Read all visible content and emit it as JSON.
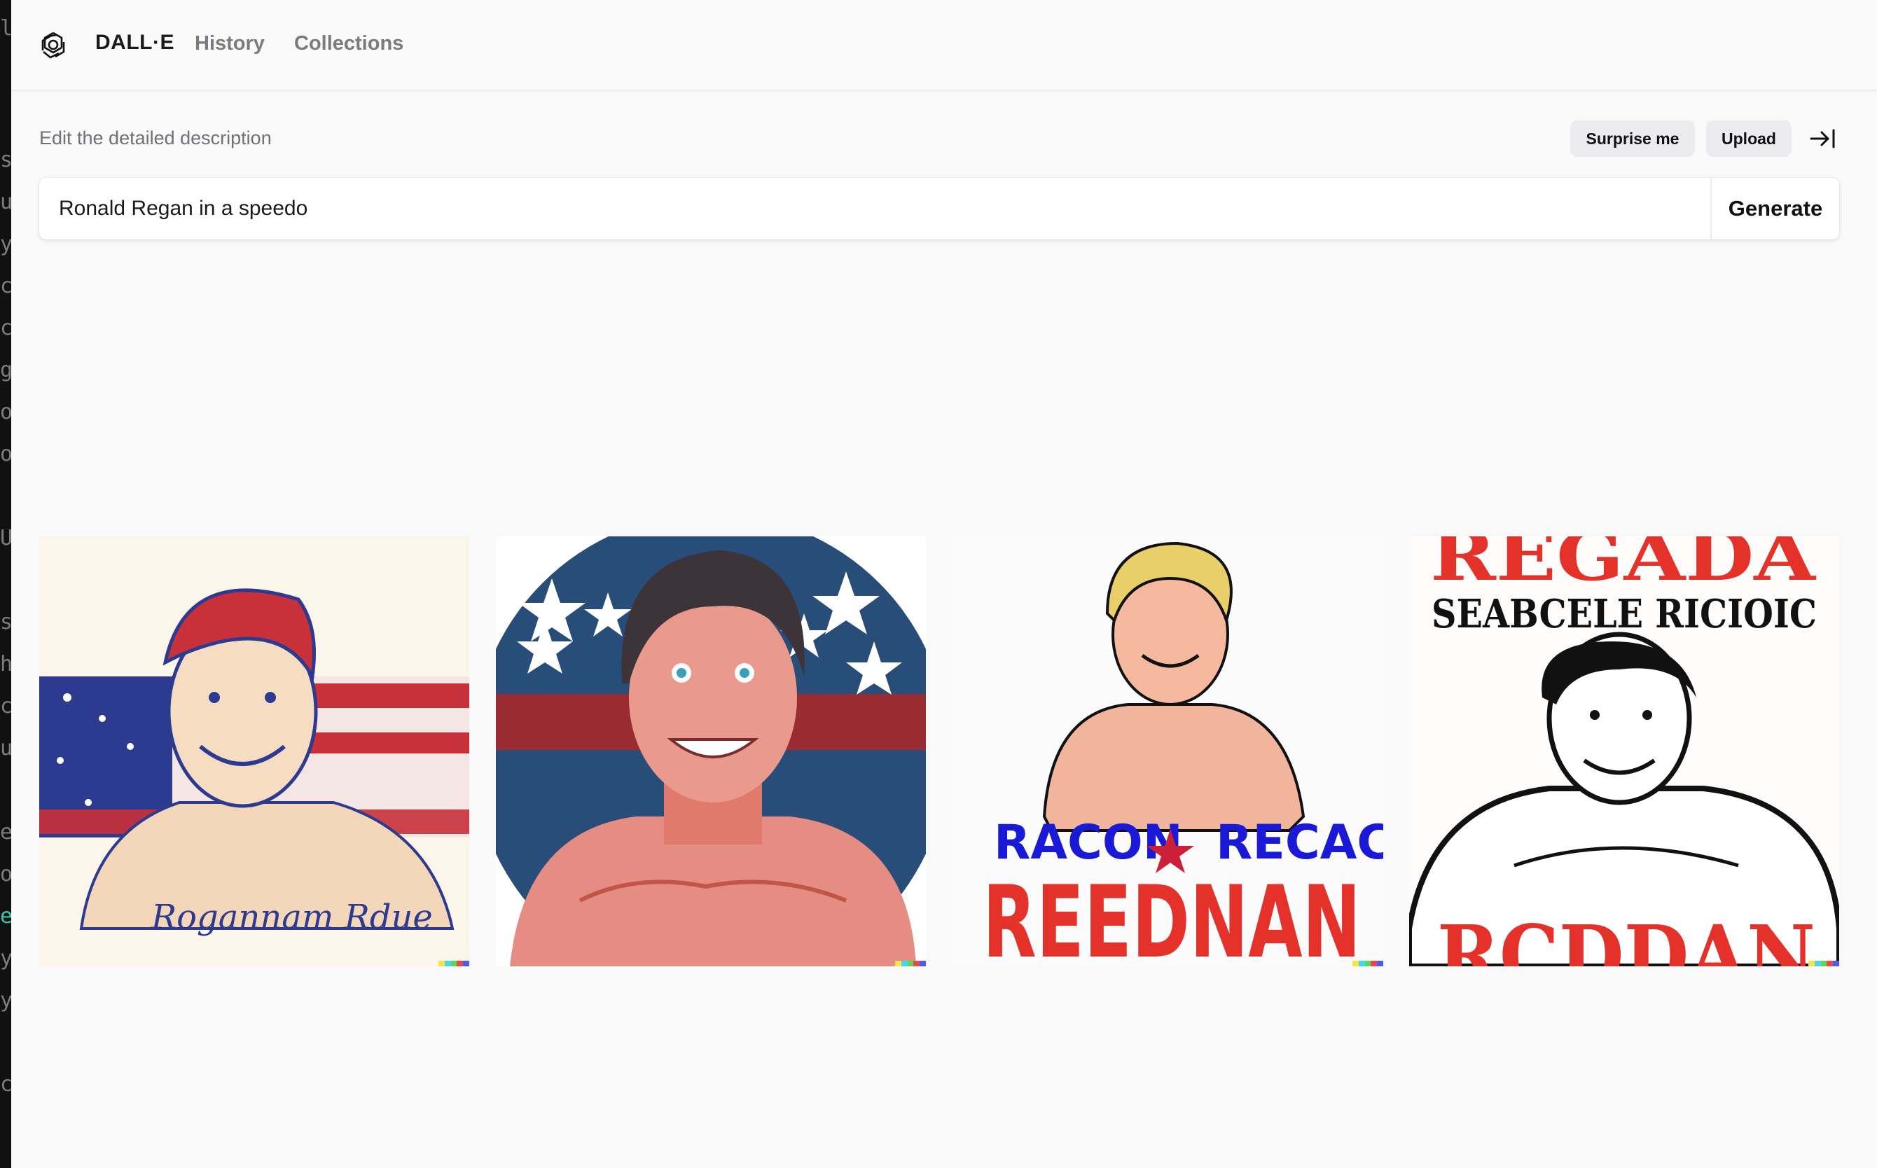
{
  "header": {
    "brand": "DALL·E",
    "nav": [
      {
        "label": "History"
      },
      {
        "label": "Collections"
      }
    ]
  },
  "toolbar": {
    "prompt_label": "Edit the detailed description",
    "surprise_label": "Surprise me",
    "upload_label": "Upload"
  },
  "prompt": {
    "value": "Ronald Regan in a speedo",
    "generate_label": "Generate"
  },
  "images": [
    {
      "art_text": "Rogannam Rdue"
    },
    {
      "art_text": ""
    },
    {
      "art_text_top": "RACON",
      "art_text_top_right": "RECACY",
      "art_text_main": "REEDNAN"
    },
    {
      "art_text_top": "REGADA",
      "art_text_sub": "SEABCELE RICIOIC",
      "art_text_main": "RCDDAN"
    }
  ],
  "colors": {
    "background": "#f9f9fa",
    "flag_red": "#b8282e",
    "flag_blue": "#274d78",
    "poster_red": "#e4322b",
    "poster_blue": "#1a1ad6"
  }
}
